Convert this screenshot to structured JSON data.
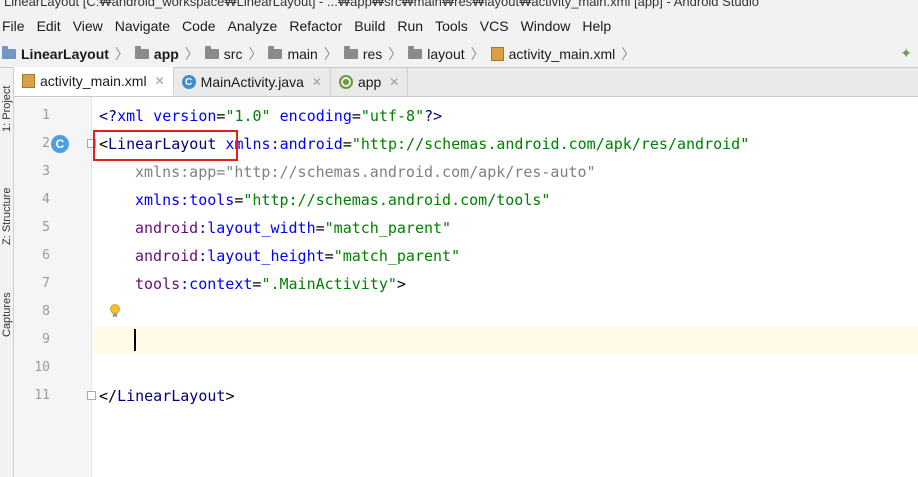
{
  "window": {
    "title": "LinearLayout [C:₩android_workspace₩LinearLayout] - ...₩app₩src₩main₩res₩layout₩activity_main.xml [app] - Android Studio"
  },
  "menu": {
    "items": [
      "File",
      "Edit",
      "View",
      "Navigate",
      "Code",
      "Analyze",
      "Refactor",
      "Build",
      "Run",
      "Tools",
      "VCS",
      "Window",
      "Help"
    ]
  },
  "breadcrumbs": {
    "items": [
      "LinearLayout",
      "app",
      "src",
      "main",
      "res",
      "layout",
      "activity_main.xml"
    ]
  },
  "side_panels": {
    "project": "1: Project",
    "structure": "Z: Structure",
    "captures": "Captures"
  },
  "tabs": [
    {
      "label": "activity_main.xml",
      "icon": "xml-file-icon"
    },
    {
      "label": "MainActivity.java",
      "icon": "class-icon"
    },
    {
      "label": "app",
      "icon": "android-app-icon"
    }
  ],
  "editor": {
    "line_numbers": [
      "1",
      "2",
      "3",
      "4",
      "5",
      "6",
      "7",
      "8",
      "9",
      "10",
      "11"
    ],
    "code": {
      "l1a": "<?",
      "l1b": "xml version",
      "l1c": "=",
      "l1d": "\"1.0\"",
      "l1e": " encoding",
      "l1f": "=",
      "l1g": "\"utf-8\"",
      "l1h": "?>",
      "l2a": "<",
      "l2b": "LinearLayout",
      "l2c": " xmlns:",
      "l2d": "android",
      "l2e": "=",
      "l2f": "\"http://schemas.android.com/apk/res/android\"",
      "l3": "xmlns:app=\"http://schemas.android.com/apk/res-auto\"",
      "l4a": "xmlns:",
      "l4b": "tools",
      "l4c": "=",
      "l4d": "\"http://schemas.android.com/tools\"",
      "l5a": "android",
      "l5b": ":layout_width",
      "l5c": "=",
      "l5d": "\"match_parent\"",
      "l6a": "android",
      "l6b": ":layout_height",
      "l6c": "=",
      "l6d": "\"match_parent\"",
      "l7a": "tools",
      "l7b": ":context",
      "l7c": "=",
      "l7d": "\".MainActivity\"",
      "l7e": ">",
      "l11a": "</",
      "l11b": "LinearLayout",
      "l11c": ">"
    }
  },
  "colors": {
    "highlight_box": "#e02020",
    "current_line": "#fffbe6"
  }
}
